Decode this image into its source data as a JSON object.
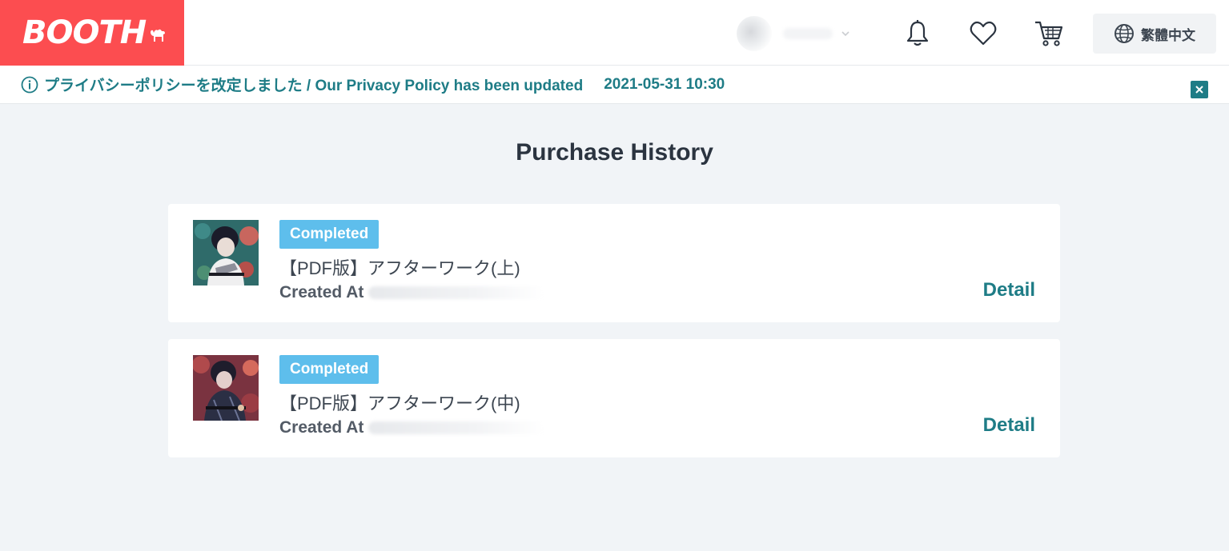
{
  "header": {
    "logo_text": "BOOTH",
    "language_label": "繁體中文"
  },
  "notice": {
    "text": "プライバシーポリシーを改定しました / Our Privacy Policy has been updated",
    "date": "2021-05-31 10:30"
  },
  "page_title": "Purchase History",
  "orders": [
    {
      "status": "Completed",
      "title": "【PDF版】アフターワーク(上)",
      "created_at_label": "Created At",
      "detail_label": "Detail"
    },
    {
      "status": "Completed",
      "title": "【PDF版】アフターワーク(中)",
      "created_at_label": "Created At",
      "detail_label": "Detail"
    }
  ],
  "colors": {
    "brand": "#fc4d50",
    "accent": "#1e7c86",
    "badge": "#5ebeec",
    "background": "#f1f4f7"
  },
  "icons": [
    "camel-icon",
    "chevron-down-icon",
    "bell-icon",
    "heart-icon",
    "cart-icon",
    "globe-icon",
    "info-icon",
    "close-icon"
  ]
}
